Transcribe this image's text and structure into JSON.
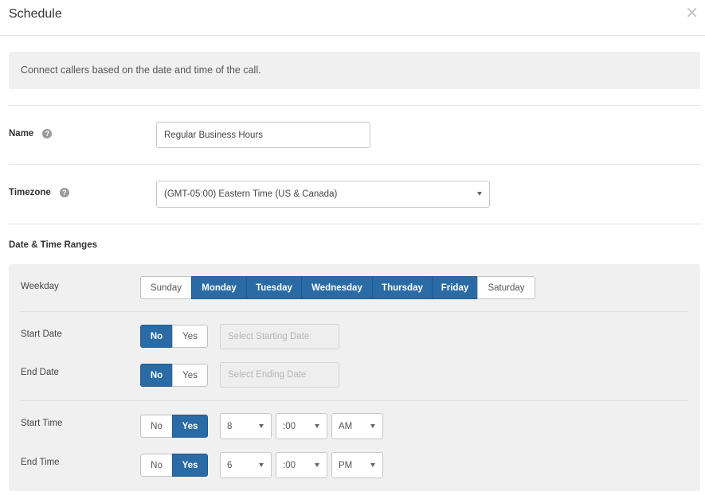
{
  "header": {
    "title": "Schedule",
    "close_glyph": "✕"
  },
  "intro": {
    "text": "Connect callers based on the date and time of the call."
  },
  "name_field": {
    "label": "Name",
    "help_glyph": "?",
    "value": "Regular Business Hours"
  },
  "timezone_field": {
    "label": "Timezone",
    "help_glyph": "?",
    "value": "(GMT-05:00) Eastern Time (US & Canada)"
  },
  "ranges": {
    "title": "Date & Time Ranges",
    "weekday": {
      "label": "Weekday",
      "days": [
        {
          "label": "Sunday",
          "selected": false
        },
        {
          "label": "Monday",
          "selected": true
        },
        {
          "label": "Tuesday",
          "selected": true
        },
        {
          "label": "Wednesday",
          "selected": true
        },
        {
          "label": "Thursday",
          "selected": true
        },
        {
          "label": "Friday",
          "selected": true
        },
        {
          "label": "Saturday",
          "selected": false
        }
      ]
    },
    "start_date": {
      "label": "Start Date",
      "no": "No",
      "yes": "Yes",
      "selected": "No",
      "placeholder": "Select Starting Date"
    },
    "end_date": {
      "label": "End Date",
      "no": "No",
      "yes": "Yes",
      "selected": "No",
      "placeholder": "Select Ending Date"
    },
    "start_time": {
      "label": "Start Time",
      "no": "No",
      "yes": "Yes",
      "selected": "Yes",
      "hour": "8",
      "minute": ":00",
      "ampm": "AM"
    },
    "end_time": {
      "label": "End Time",
      "no": "No",
      "yes": "Yes",
      "selected": "Yes",
      "hour": "6",
      "minute": ":00",
      "ampm": "PM"
    }
  },
  "colors": {
    "accent": "#2a6ba6",
    "panel_bg": "#f0f0f0"
  }
}
